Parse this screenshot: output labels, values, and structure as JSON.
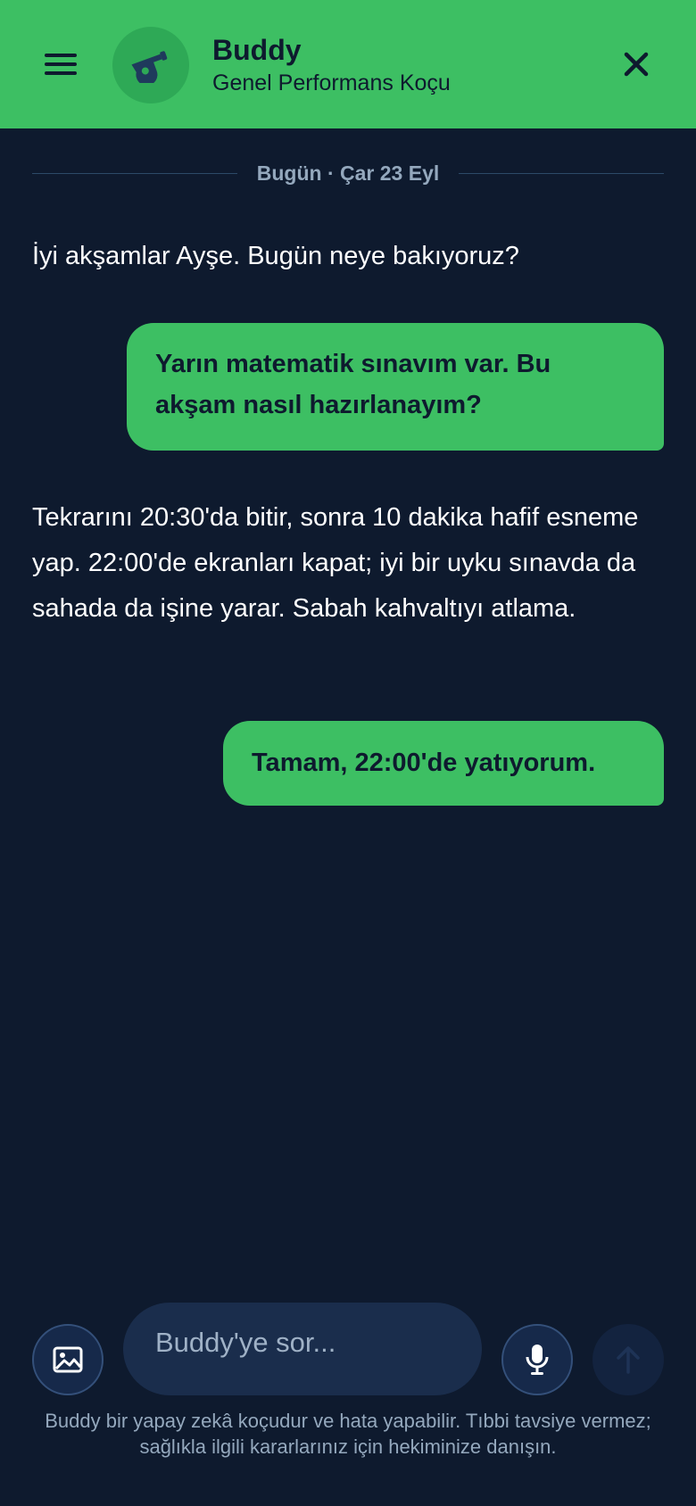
{
  "header": {
    "title": "Buddy",
    "subtitle": "Genel Performans Koçu",
    "menu_icon": "hamburger-menu-icon",
    "avatar_icon": "whistle-icon",
    "close_icon": "close-icon"
  },
  "date_separator": "Bugün · Çar 23 Eyl",
  "messages": [
    {
      "role": "assistant",
      "text": "İyi akşamlar Ayşe. Bugün neye bakıyoruz?"
    },
    {
      "role": "user",
      "text": "Yarın matematik sınavım var. Bu akşam nasıl hazırlanayım?"
    },
    {
      "role": "assistant",
      "text": "Tekrarını 20:30'da bitir, sonra 10 dakika hafif esneme yap. 22:00'de ekranları kapat; iyi bir uyku sınavda da sahada da işine yarar. Sabah kahvaltıyı atlama."
    },
    {
      "role": "user",
      "text": "Tamam, 22:00'de yatıyorum."
    }
  ],
  "composer": {
    "placeholder": "Buddy'ye sor...",
    "image_icon": "image-icon",
    "mic_icon": "microphone-icon",
    "send_icon": "arrow-up-icon"
  },
  "disclaimer": "Buddy bir yapay zekâ koçudur ve hata yapabilir. Tıbbi tavsiye vermez; sağlıkla ilgili kararlarınız için hekiminize danışın.",
  "colors": {
    "accent": "#3dbf63",
    "background": "#0e1a2e",
    "surface": "#1a2d4c",
    "muted_text": "#94a8bd"
  }
}
